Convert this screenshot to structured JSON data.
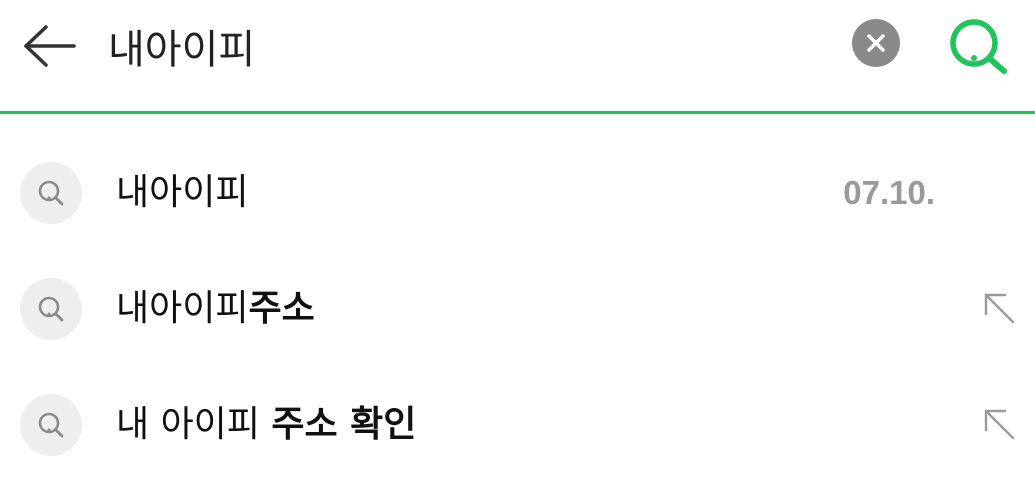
{
  "search": {
    "query": "내아이피"
  },
  "icons": {
    "back": "arrow-left-icon",
    "clear": "close-circle-icon",
    "search": "search-icon",
    "suggestion": "search-icon",
    "fill": "arrow-up-left-icon"
  },
  "colors": {
    "accent": "#1fc45a",
    "clear_bg": "#8a8a8a",
    "icon_bg": "#eeeeee",
    "muted": "#9a9a9a"
  },
  "suggestions": [
    {
      "parts": [
        {
          "text": "내아이피",
          "bold": false
        }
      ],
      "date": "07.10."
    },
    {
      "parts": [
        {
          "text": "내아이피",
          "bold": false
        },
        {
          "text": "주소",
          "bold": true
        }
      ]
    },
    {
      "parts": [
        {
          "text": "내 아이피 ",
          "bold": false
        },
        {
          "text": "주소 확인",
          "bold": true
        }
      ]
    }
  ]
}
